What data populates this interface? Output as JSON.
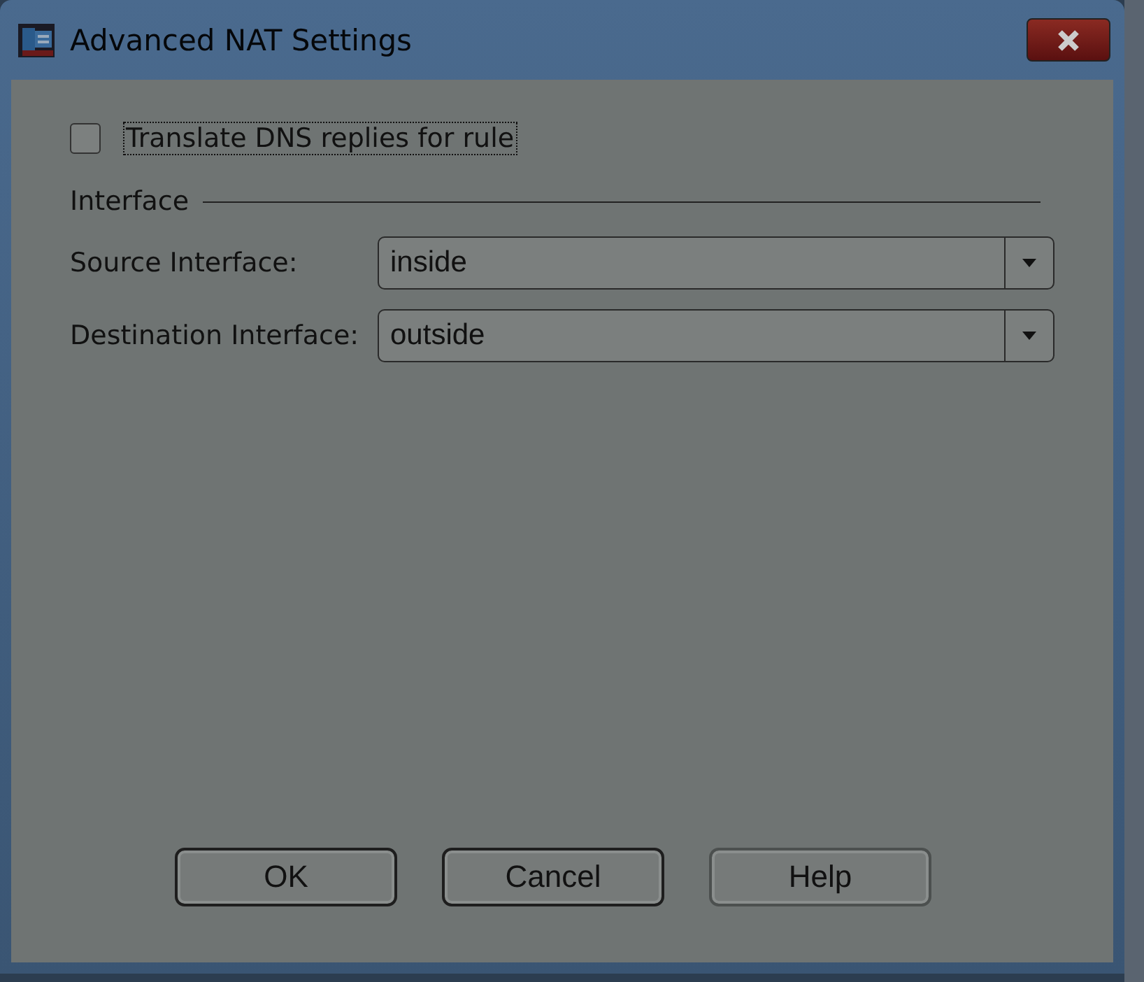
{
  "window": {
    "title": "Advanced NAT Settings"
  },
  "translate_dns": {
    "label": "Translate DNS replies for rule",
    "checked": false
  },
  "group": {
    "title": "Interface",
    "fields": [
      {
        "label": "Source Interface:",
        "value": "inside"
      },
      {
        "label": "Destination Interface:",
        "value": "outside"
      }
    ]
  },
  "buttons": [
    "OK",
    "Cancel",
    "Help"
  ]
}
